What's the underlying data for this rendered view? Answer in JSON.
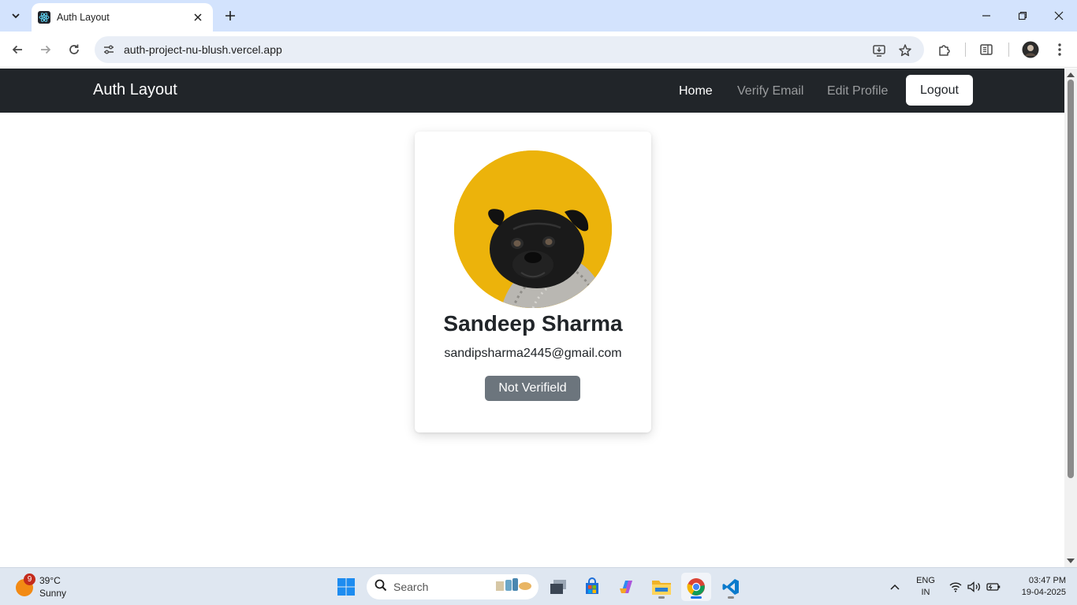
{
  "browser": {
    "tab_title": "Auth Layout",
    "url": "auth-project-nu-blush.vercel.app"
  },
  "navbar": {
    "brand": "Auth Layout",
    "links": [
      {
        "label": "Home",
        "active": true
      },
      {
        "label": "Verify Email",
        "active": false
      },
      {
        "label": "Edit Profile",
        "active": false
      }
    ],
    "logout_label": "Logout"
  },
  "profile": {
    "name": "Sandeep Sharma",
    "email": "sandipsharma2445@gmail.com",
    "status_label": "Not Verifield",
    "avatar_icon": "pug-avatar"
  },
  "taskbar": {
    "weather_badge": "9",
    "weather_temp": "39°C",
    "weather_desc": "Sunny",
    "search_placeholder": "Search",
    "lang_line1": "ENG",
    "lang_line2": "IN",
    "time": "03:47 PM",
    "date": "19-04-2025"
  },
  "colors": {
    "navbar_bg": "#212529",
    "chrome_tabstrip": "#d3e3fd",
    "status_badge": "#6c757d",
    "avatar_bg": "#ecb30b"
  }
}
